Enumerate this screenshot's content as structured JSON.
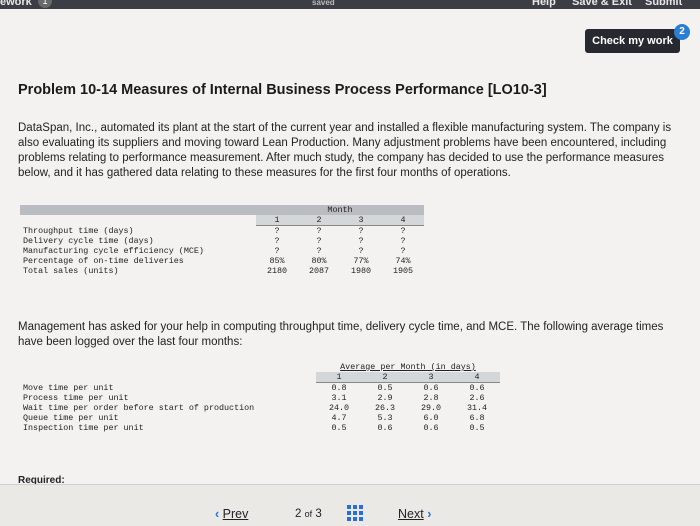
{
  "topbar": {
    "left_label": "ework",
    "badge": "1",
    "center_label": "saved",
    "help": "Help",
    "save_exit": "Save & Exit",
    "submit": "Submit"
  },
  "check": {
    "label": "Check my work",
    "badge": "2"
  },
  "problem": {
    "title": "Problem 10-14 Measures of Internal Business Process Performance [LO10-3]",
    "intro": "DataSpan, Inc., automated its plant at the start of the current year and installed a flexible manufacturing system. The company is also evaluating its suppliers and moving toward Lean Production. Many adjustment problems have been encountered, including problems relating to performance measurement. After much study, the company has decided to use the performance measures below, and it has gathered data relating to these measures for the first four months of operations."
  },
  "table1": {
    "header": "Month",
    "months": [
      "1",
      "2",
      "3",
      "4"
    ],
    "rows": [
      {
        "label": "Throughput time (days)",
        "values": [
          "?",
          "?",
          "?",
          "?"
        ]
      },
      {
        "label": "Delivery cycle time (days)",
        "values": [
          "?",
          "?",
          "?",
          "?"
        ]
      },
      {
        "label": "Manufacturing cycle efficiency (MCE)",
        "values": [
          "?",
          "?",
          "?",
          "?"
        ]
      },
      {
        "label": "Percentage of on-time deliveries",
        "values": [
          "85%",
          "80%",
          "77%",
          "74%"
        ]
      },
      {
        "label": "Total sales (units)",
        "values": [
          "2180",
          "2087",
          "1980",
          "1905"
        ]
      }
    ]
  },
  "paragraph2": "Management has asked for your help in computing throughput time, delivery cycle time, and MCE. The following average times have been logged over the last four months:",
  "table2": {
    "header": "Average per Month (in days)",
    "months": [
      "1",
      "2",
      "3",
      "4"
    ],
    "rows": [
      {
        "label": "Move time per unit",
        "values": [
          "0.8",
          "0.5",
          "0.6",
          "0.6"
        ]
      },
      {
        "label": "Process time per unit",
        "values": [
          "3.1",
          "2.9",
          "2.8",
          "2.6"
        ]
      },
      {
        "label": "Wait time per order before start of production",
        "values": [
          "24.0",
          "26.3",
          "29.0",
          "31.4"
        ]
      },
      {
        "label": "Queue time per unit",
        "values": [
          "4.7",
          "5.3",
          "6.0",
          "6.8"
        ]
      },
      {
        "label": "Inspection time per unit",
        "values": [
          "0.5",
          "0.6",
          "0.6",
          "0.5"
        ]
      }
    ]
  },
  "required_label": "Required:",
  "footer": {
    "prev": "Prev",
    "page_current": "2",
    "page_of": "of",
    "page_total": "3",
    "next": "Next"
  },
  "colors": {
    "accent": "#2a7fd4",
    "topbar": "#3b3f45",
    "button": "#262a30"
  }
}
